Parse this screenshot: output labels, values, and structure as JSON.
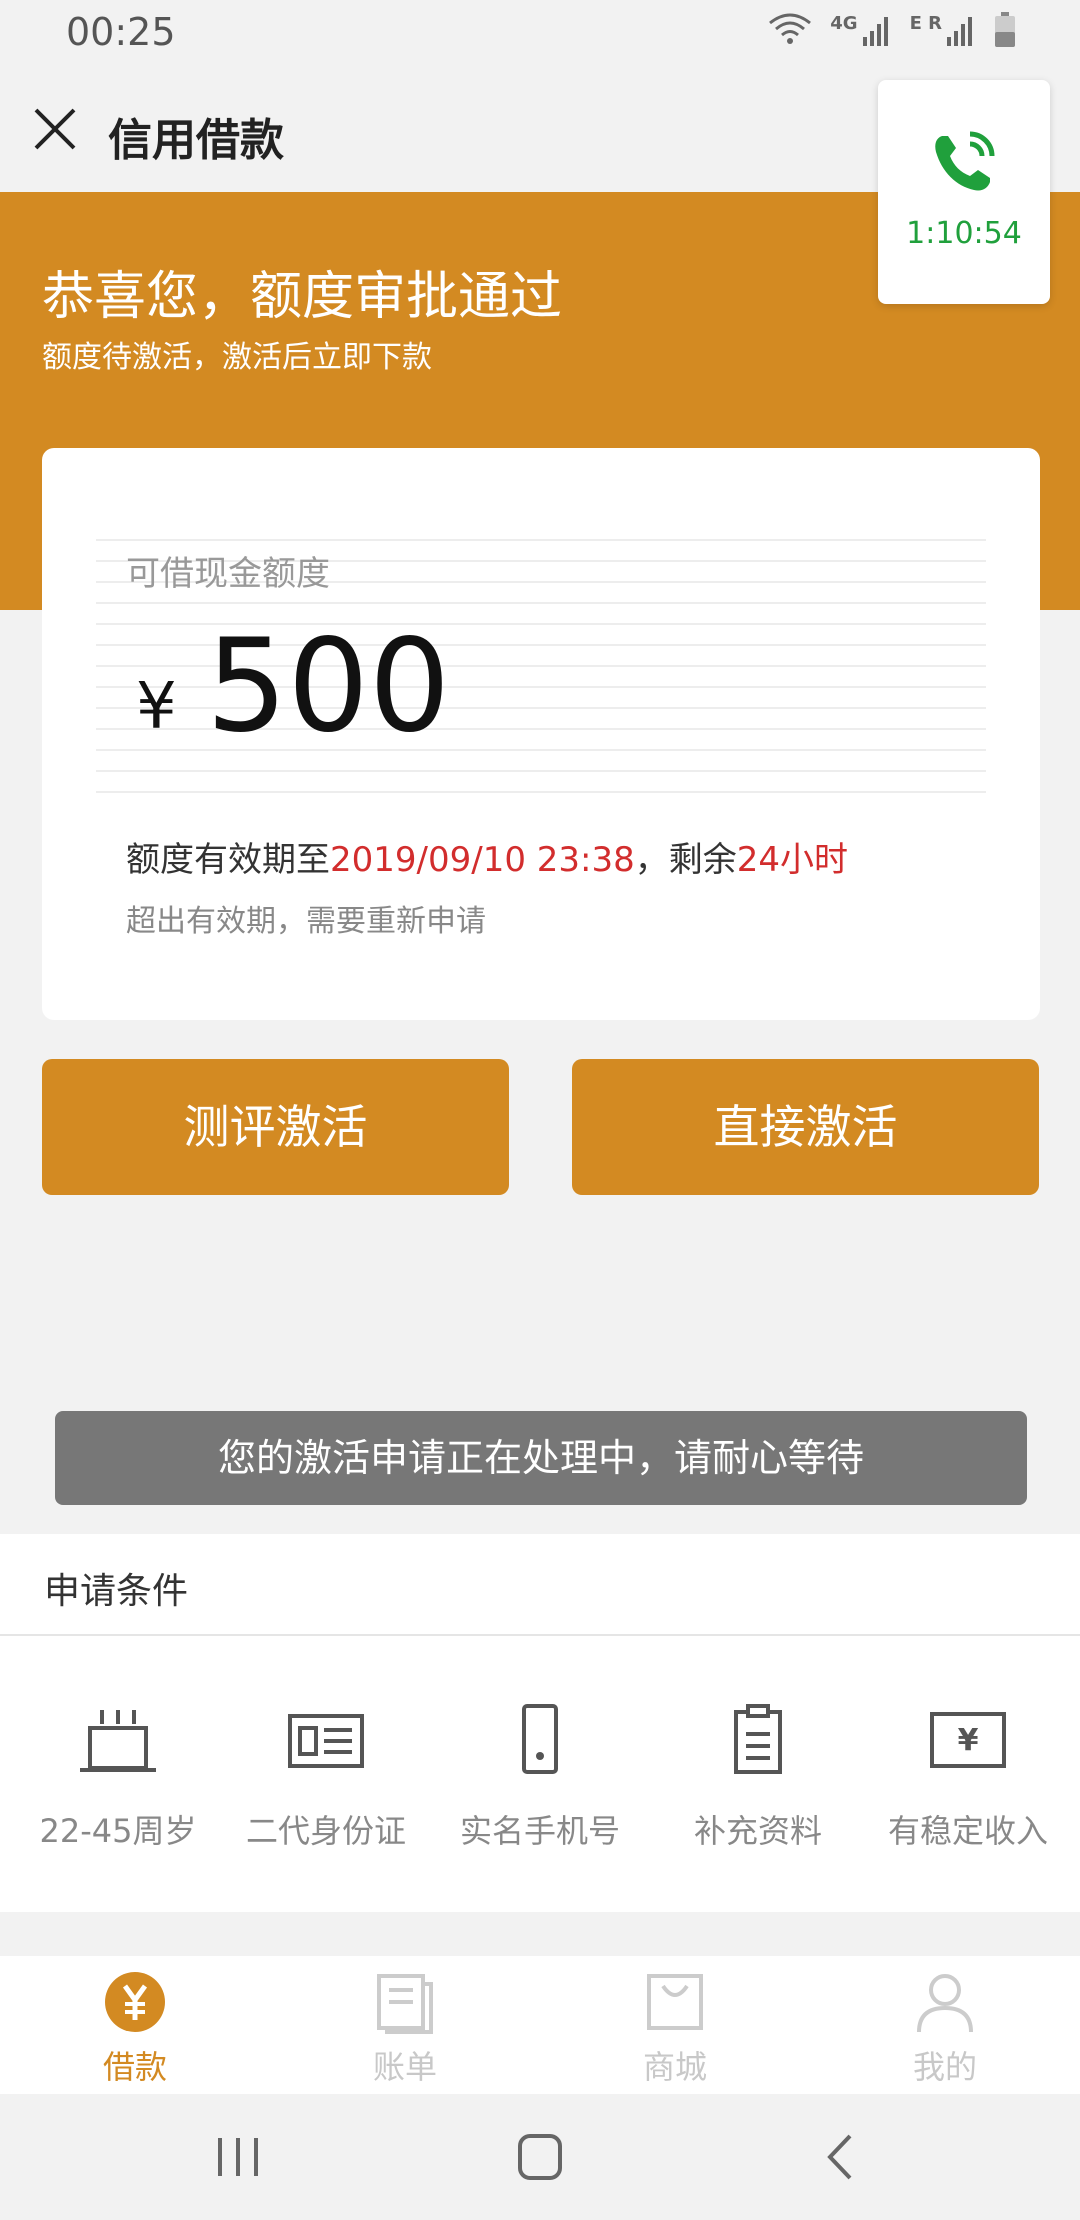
{
  "status_bar": {
    "time": "00:25",
    "network_label": "4G",
    "signal2_label": "E R"
  },
  "header": {
    "title": "信用借款"
  },
  "call_widget": {
    "duration": "1:10:54",
    "color": "#20a03c"
  },
  "banner": {
    "title": "恭喜您，额度审批通过",
    "subtitle": "额度待激活，激活后立即下款",
    "color": "#d38a22"
  },
  "card": {
    "label": "可借现金额度",
    "currency": "¥",
    "amount": "500",
    "validity_prefix": "额度有效期至",
    "validity_date": "2019/09/10 23:38",
    "validity_middle": "，剩余",
    "validity_remaining": "24小时",
    "note": "超出有效期，需要重新申请"
  },
  "actions": {
    "eval_activate": "测评激活",
    "direct_activate": "直接激活"
  },
  "toast": {
    "message": "您的激活申请正在处理中，请耐心等待"
  },
  "conditions": {
    "title": "申请条件",
    "items": [
      {
        "label": "22-45周岁",
        "icon": "cake-icon"
      },
      {
        "label": "二代身份证",
        "icon": "id-card-icon"
      },
      {
        "label": "实名手机号",
        "icon": "phone-device-icon"
      },
      {
        "label": "补充资料",
        "icon": "clipboard-icon"
      },
      {
        "label": "有稳定收入",
        "icon": "income-icon"
      }
    ]
  },
  "bottom_nav": {
    "items": [
      {
        "label": "借款",
        "icon": "loan-yen-icon",
        "active": true
      },
      {
        "label": "账单",
        "icon": "bill-icon",
        "active": false
      },
      {
        "label": "商城",
        "icon": "shop-bag-icon",
        "active": false
      },
      {
        "label": "我的",
        "icon": "profile-icon",
        "active": false
      }
    ]
  }
}
